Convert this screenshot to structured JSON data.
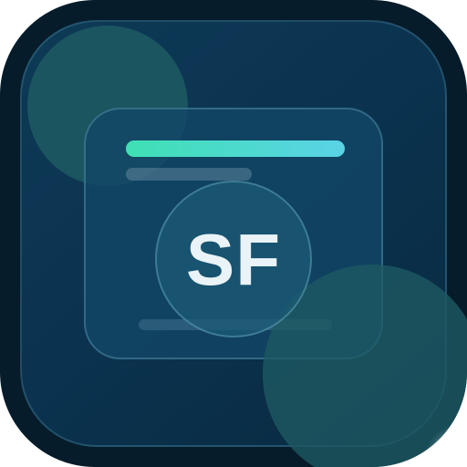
{
  "app_icon": {
    "monogram": "SF",
    "colors": {
      "outer_frame": "#061c2a",
      "panel": "#0d3a56",
      "card": "#124666",
      "accent_gradient_start": "#3fe0b4",
      "accent_gradient_end": "#5ad3e6",
      "blob": "#1e5a63",
      "monogram_text": "#e9f3f8"
    }
  }
}
